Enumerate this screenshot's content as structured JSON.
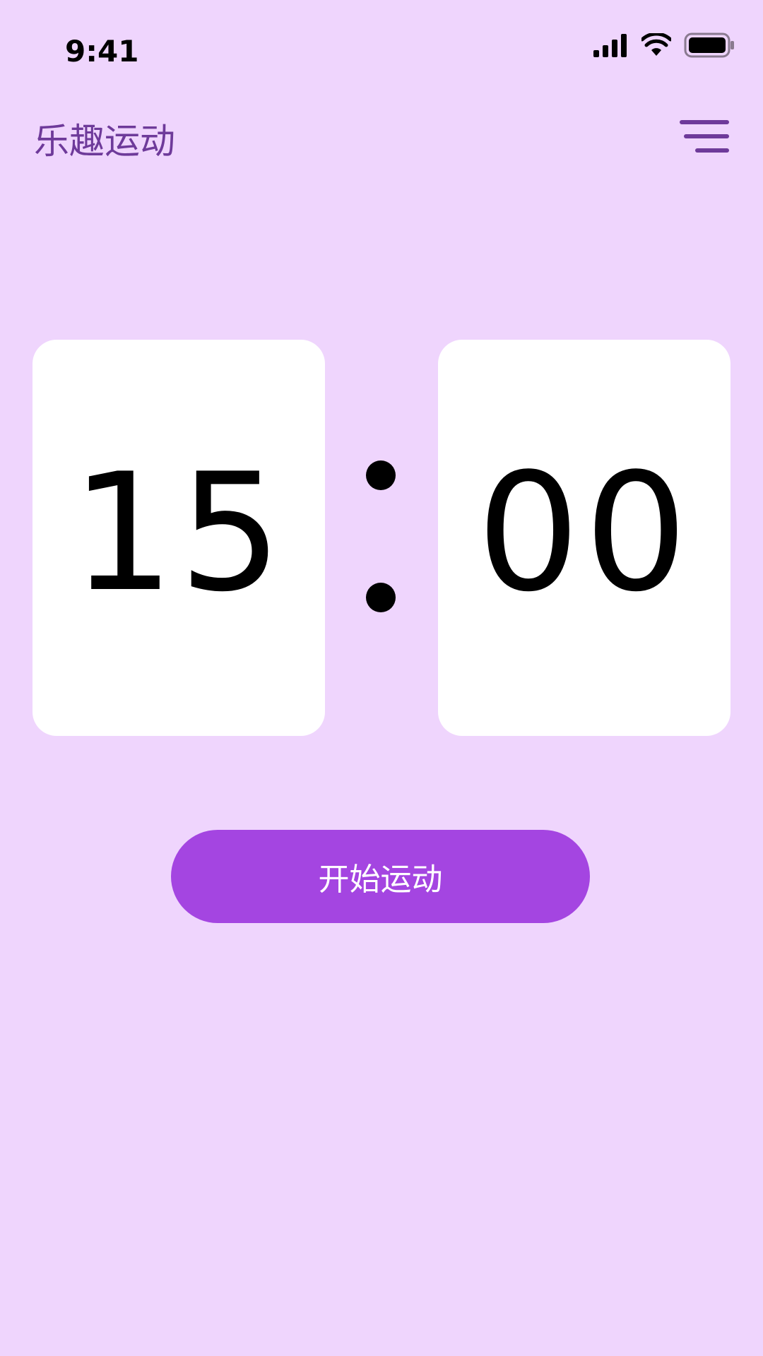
{
  "status_bar": {
    "time": "9:41",
    "icons": [
      "signal-icon",
      "wifi-icon",
      "battery-icon"
    ]
  },
  "header": {
    "title": "乐趣运动",
    "menu_icon": "menu-icon"
  },
  "timer": {
    "minutes": "15",
    "seconds": "00"
  },
  "actions": {
    "start_label": "开始运动"
  },
  "colors": {
    "background": "#efd5fd",
    "accent": "#a445e1",
    "title": "#6e3a9a",
    "card": "#ffffff"
  }
}
